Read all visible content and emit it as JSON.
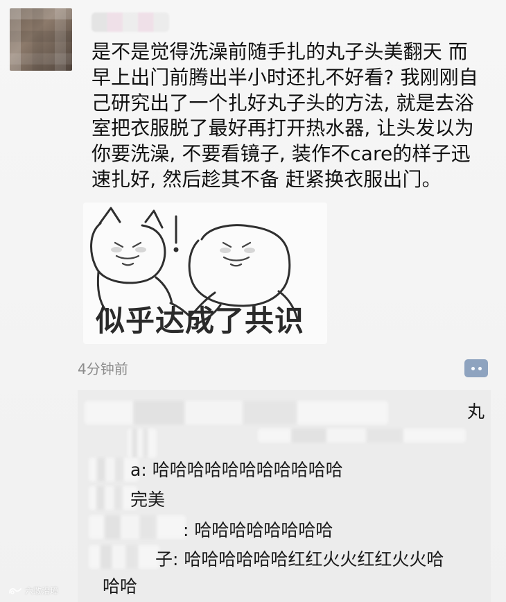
{
  "post": {
    "text": "是不是觉得洗澡前随手扎的丸子头美翻天 而\n早上出门前腾出半小时还扎不好看? 我刚刚自\n己研究出了一个扎好丸子头的方法, 就是去浴\n室把衣服脱了最好再打开热水器, 让头发以为\n你要洗澡, 不要看镜子, 装作不care的样子迅\n速扎好, 然后趁其不备 赶紧换衣服出门。",
    "meme_caption": "似乎达成了共识",
    "timestamp": "4分钟前",
    "comment_icon": "comment-icon"
  },
  "comments": {
    "partial_top_right": "丸",
    "line_1": "a: 哈哈哈哈哈哈哈哈哈哈哈",
    "line_2": "完美",
    "line_3": ": 哈哈哈哈哈哈哈哈",
    "line_4": "子: 哈哈哈哈哈哈红红火火红红火火哈",
    "line_5": "哈哈"
  },
  "watermark": {
    "text": "六敢沿璋"
  },
  "colors": {
    "comment_button": "#8ea3bf",
    "panel_background": "#ececec"
  }
}
